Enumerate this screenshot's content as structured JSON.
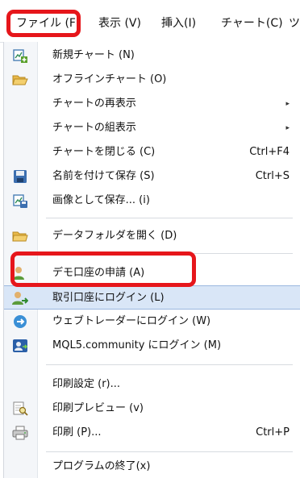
{
  "menubar": {
    "items": [
      {
        "label": "ファイル (F)"
      },
      {
        "label": "表示 (V)"
      },
      {
        "label": "挿入(I)"
      },
      {
        "label": "チャート(C)"
      },
      {
        "label": "ツ"
      }
    ]
  },
  "file_menu": {
    "items": [
      {
        "label": "新規チャート (N)",
        "icon": "new-chart-icon"
      },
      {
        "label": "オフラインチャート (O)",
        "icon": "open-folder-icon"
      },
      {
        "label": "チャートの再表示",
        "has_submenu": true
      },
      {
        "label": "チャートの組表示",
        "has_submenu": true
      },
      {
        "label": "チャートを閉じる (C)",
        "shortcut": "Ctrl+F4"
      },
      {
        "label": "名前を付けて保存 (S)",
        "shortcut": "Ctrl+S",
        "icon": "save-icon"
      },
      {
        "label": "画像として保存... (i)",
        "icon": "save-image-icon"
      },
      {
        "label": "データフォルダを開く (D)",
        "icon": "folder-icon"
      },
      {
        "label": "デモ口座の申請 (A)",
        "icon": "demo-account-icon"
      },
      {
        "label": "取引口座にログイン (L)",
        "icon": "login-user-icon",
        "selected": true
      },
      {
        "label": "ウェブトレーダーにログイン (W)",
        "icon": "webtrader-icon"
      },
      {
        "label": "MQL5.community にログイン (M)",
        "icon": "mql5-icon"
      },
      {
        "label": "印刷設定 (r)..."
      },
      {
        "label": "印刷プレビュー (v)",
        "icon": "print-preview-icon"
      },
      {
        "label": "印刷 (P)...",
        "shortcut": "Ctrl+P",
        "icon": "printer-icon"
      },
      {
        "label": "プログラムの終了(x)"
      }
    ]
  },
  "colors": {
    "highlight_border": "#e6161b",
    "selected_background": "#d9e6f7",
    "gutter": "#f4f6f9"
  }
}
